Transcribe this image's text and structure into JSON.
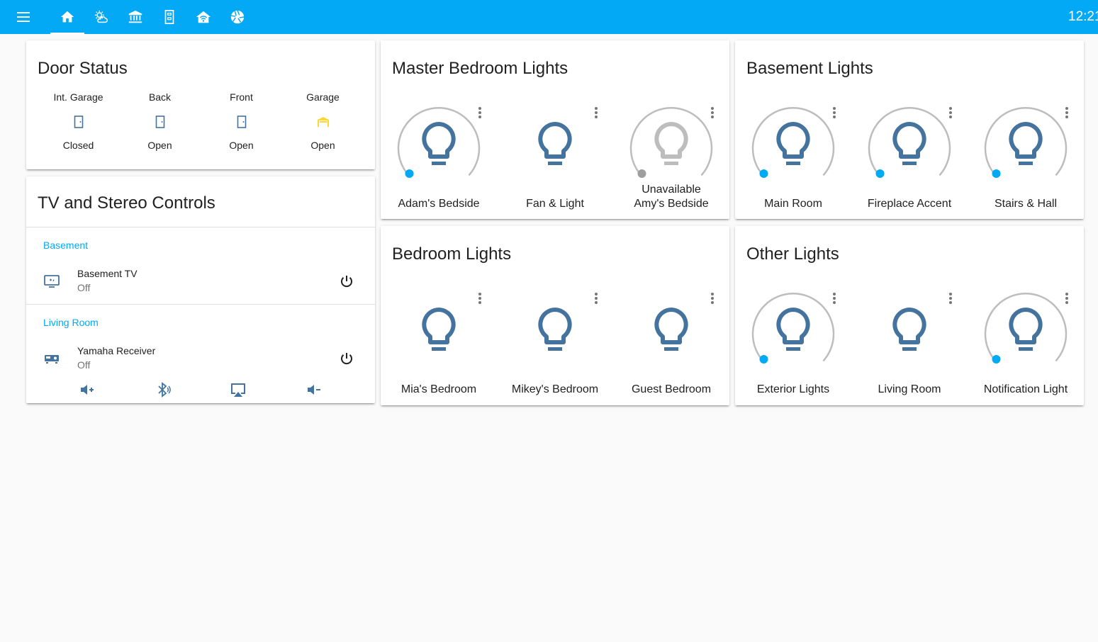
{
  "topbar": {
    "tabs": [
      {
        "icon": "home-icon",
        "active": true
      },
      {
        "icon": "weather-icon",
        "active": false
      },
      {
        "icon": "bank-icon",
        "active": false
      },
      {
        "icon": "door-icon",
        "active": false
      },
      {
        "icon": "home-wifi-icon",
        "active": false
      },
      {
        "icon": "camera-iris-icon",
        "active": false
      }
    ],
    "clock": "12:21"
  },
  "door_status": {
    "title": "Door Status",
    "doors": [
      {
        "name": "Int. Garage",
        "state": "Closed",
        "icon": "door-closed-icon",
        "color": "#44739e"
      },
      {
        "name": "Back",
        "state": "Open",
        "icon": "door-icon",
        "color": "#44739e"
      },
      {
        "name": "Front",
        "state": "Open",
        "icon": "door-icon",
        "color": "#44739e"
      },
      {
        "name": "Garage",
        "state": "Open",
        "icon": "garage-open-icon",
        "color": "#fdd835"
      }
    ]
  },
  "tv_stereo": {
    "title": "TV and Stereo Controls",
    "groups": [
      {
        "label": "Basement",
        "device": "Basement TV",
        "state": "Off",
        "icon": "tv-icon"
      },
      {
        "label": "Living Room",
        "device": "Yamaha Receiver",
        "state": "Off",
        "icon": "receiver-icon"
      }
    ],
    "controls": [
      "volume-plus-icon",
      "bluetooth-audio-icon",
      "airplay-icon",
      "volume-minus-icon"
    ]
  },
  "master_bedroom": {
    "title": "Master Bedroom Lights",
    "lights": [
      {
        "name": "Adam's Bedside",
        "dial": true,
        "available": true
      },
      {
        "name": "Fan & Light",
        "dial": false,
        "available": true
      },
      {
        "name": "Amy's Bedside",
        "dial": true,
        "available": false,
        "status": "Unavailable"
      }
    ]
  },
  "basement_lights": {
    "title": "Basement Lights",
    "lights": [
      {
        "name": "Main Room",
        "dial": true
      },
      {
        "name": "Fireplace Accent",
        "dial": true
      },
      {
        "name": "Stairs & Hall",
        "dial": true
      }
    ]
  },
  "bedroom_lights": {
    "title": "Bedroom Lights",
    "lights": [
      {
        "name": "Mia's Bedroom",
        "dial": false
      },
      {
        "name": "Mikey's Bedroom",
        "dial": false
      },
      {
        "name": "Guest Bedroom",
        "dial": false
      }
    ]
  },
  "other_lights": {
    "title": "Other Lights",
    "lights": [
      {
        "name": "Exterior Lights",
        "dial": true
      },
      {
        "name": "Living Room",
        "dial": false
      },
      {
        "name": "Notification Light",
        "dial": true
      }
    ]
  },
  "colors": {
    "primary": "#03a9f4",
    "icon": "#44739e",
    "unavailable": "#bdbdbd",
    "garage_open": "#fdd835"
  }
}
